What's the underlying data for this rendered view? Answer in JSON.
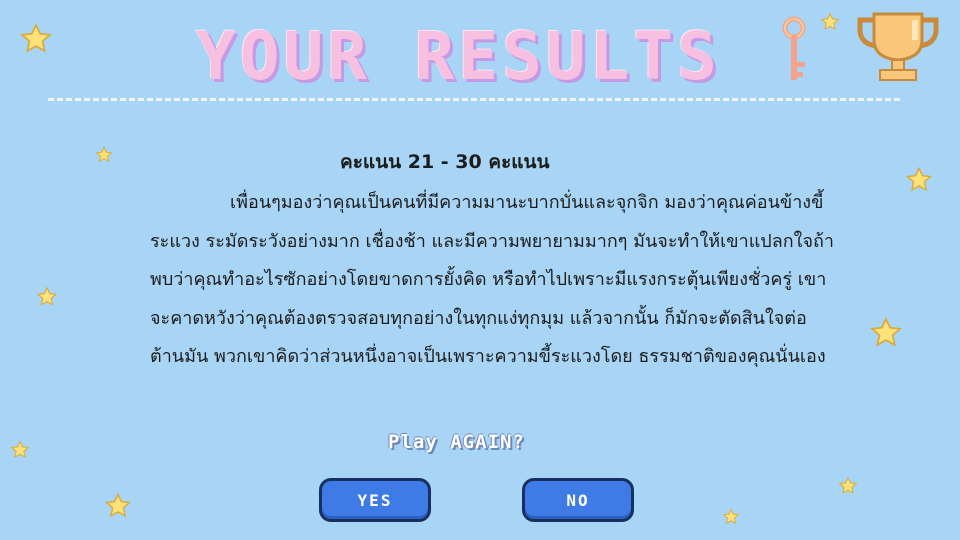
{
  "header": {
    "title": "YOUR RESULTS",
    "key_icon": "key-icon",
    "trophy_icon": "trophy-icon"
  },
  "result": {
    "score_range": "คะแนน 21 - 30 คะแนน",
    "description": "เพื่อนๆมองว่าคุณเป็นคนที่มีความมานะบากบั่นและจุกจิก มองว่าคุณค่อนข้างขี้ระแวง ระมัดระวังอย่างมาก เชื่องช้า และมีความพยายามมากๆ มันจะทำให้เขาแปลกใจถ้าพบว่าคุณทำอะไรซักอย่างโดยขาดการยั้งคิด หรือทำไปเพราะมีแรงกระตุ้นเพียงชั่วครู่ เขาจะคาดหวังว่าคุณต้องตรวจสอบทุกอย่างในทุกแง่ทุกมุม แล้วจากนั้น ก็มักจะตัดสินใจต่อต้านมัน พวกเขาคิดว่าส่วนหนึ่งอาจเป็นเพราะความขี้ระแวงโดย ธรรมชาติของคุณนั่นเอง"
  },
  "prompt": {
    "play_again": "Play AGAIN?",
    "yes_label": "YES",
    "no_label": "NO"
  },
  "colors": {
    "background": "#a8d5f5",
    "title": "#f7bfe0",
    "title_shadow": "#c39ae6",
    "button": "#3f7be6",
    "button_border": "#17305f",
    "star": "#ffe27a"
  },
  "decorations": {
    "star_icon": "star-icon"
  }
}
